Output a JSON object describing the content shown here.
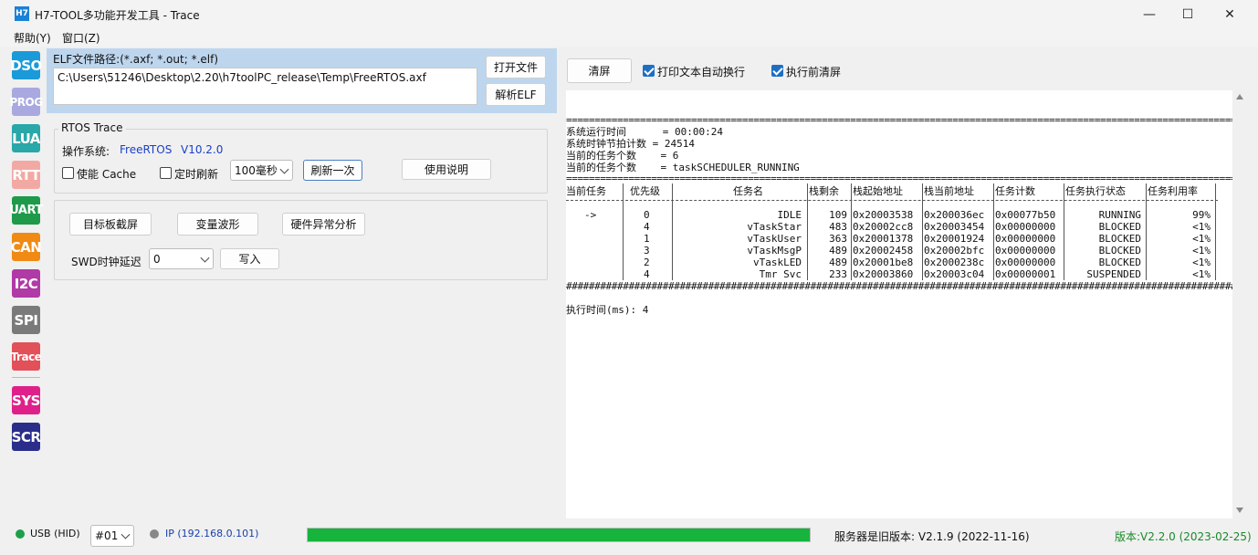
{
  "window": {
    "title": "H7-TOOL多功能开发工具 - Trace",
    "icon_label": "H7",
    "minimize_glyph": "—",
    "maximize_glyph": "☐",
    "close_glyph": "✕"
  },
  "menu": {
    "items": [
      "帮助(Y)",
      "窗口(Z)"
    ]
  },
  "sidebar": {
    "items": [
      {
        "label": "DSO",
        "color": "#1a9ad8"
      },
      {
        "label": "PROG",
        "color": "#a9a9e0"
      },
      {
        "label": "LUA",
        "color": "#2aa7a8"
      },
      {
        "label": "RTT",
        "color": "#f3a9a3"
      },
      {
        "label": "UART",
        "color": "#1e9a4a"
      },
      {
        "label": "CAN",
        "color": "#f08a14"
      },
      {
        "label": "I2C",
        "color": "#b03aa6"
      },
      {
        "label": "SPI",
        "color": "#7a7a7a"
      },
      {
        "label": "Trace",
        "color": "#e2505a"
      },
      {
        "label": "SYS",
        "color": "#e0208a"
      },
      {
        "label": "SCR",
        "color": "#2a2e8a"
      }
    ]
  },
  "elf": {
    "label": "ELF文件路径:(*.axf; *.out; *.elf)",
    "path": "C:\\Users\\51246\\Desktop\\2.20\\h7toolPC_release\\Temp\\FreeRTOS.axf",
    "open_button": "打开文件",
    "parse_button": "解析ELF"
  },
  "rtos": {
    "group_title": "RTOS Trace",
    "os_label": "操作系统:",
    "os_name": "FreeRTOS",
    "os_version": "V10.2.0",
    "cache_label": "使能 Cache",
    "cache_checked": false,
    "timer_label": "定时刷新",
    "timer_checked": false,
    "interval_value": "100毫秒",
    "refresh_once_button": "刷新一次",
    "help_button": "使用说明"
  },
  "tools": {
    "screenshot_button": "目标板截屏",
    "waveform_button": "变量波形",
    "fault_button": "硬件异常分析",
    "swd_label": "SWD时钟延迟",
    "swd_value": "0",
    "write_button": "写入"
  },
  "console_toolbar": {
    "clear_button": "清屏",
    "wrap_label": "打印文本自动换行",
    "wrap_checked": true,
    "clear_before_label": "执行前清屏",
    "clear_before_checked": true
  },
  "console": {
    "separator_eq": "=========================================================================================================================",
    "info_lines": [
      "系统运行时间      = 00:00:24",
      "系统时钟节拍计数 = 24514",
      "当前的任务个数    = 6",
      "当前的任务个数    = taskSCHEDULER_RUNNING"
    ],
    "table_headers": [
      "当前任务",
      "优先级",
      "任务名",
      "栈剩余",
      "栈起始地址",
      "栈当前地址",
      "任务计数",
      "任务执行状态",
      "任务利用率"
    ],
    "header_separator": "-----------+---------+----------------------------------+--------+-----------+----------+----------+----------+----------+",
    "rows": [
      {
        "current": "->",
        "priority": "0",
        "name": "IDLE",
        "stack_free": "109",
        "stack_start": "0x20003538",
        "stack_cur": "0x200036ec",
        "count": "0x00077b50",
        "state": "RUNNING",
        "usage": "99%"
      },
      {
        "current": "",
        "priority": "4",
        "name": "vTaskStar",
        "stack_free": "483",
        "stack_start": "0x20002cc8",
        "stack_cur": "0x20003454",
        "count": "0x00000000",
        "state": "BLOCKED",
        "usage": "<1%"
      },
      {
        "current": "",
        "priority": "1",
        "name": "vTaskUser",
        "stack_free": "363",
        "stack_start": "0x20001378",
        "stack_cur": "0x20001924",
        "count": "0x00000000",
        "state": "BLOCKED",
        "usage": "<1%"
      },
      {
        "current": "",
        "priority": "3",
        "name": "vTaskMsgP",
        "stack_free": "489",
        "stack_start": "0x20002458",
        "stack_cur": "0x20002bfc",
        "count": "0x00000000",
        "state": "BLOCKED",
        "usage": "<1%"
      },
      {
        "current": "",
        "priority": "2",
        "name": "vTaskLED",
        "stack_free": "489",
        "stack_start": "0x20001be8",
        "stack_cur": "0x2000238c",
        "count": "0x00000000",
        "state": "BLOCKED",
        "usage": "<1%"
      },
      {
        "current": "",
        "priority": "4",
        "name": "Tmr Svc",
        "stack_free": "233",
        "stack_start": "0x20003860",
        "stack_cur": "0x20003c04",
        "count": "0x00000001",
        "state": "SUSPENDED",
        "usage": "<1%"
      }
    ],
    "separator_hash": "#########################################################################################################################",
    "exec_time": "执行时间(ms): 4"
  },
  "statusbar": {
    "usb_label": "USB (HID)",
    "usb_color": "#1aa04a",
    "device_value": "#01",
    "ip_label": "IP (192.168.0.101)",
    "ip_color": "#888888",
    "progress_percent": 100,
    "progress_color": "#16b43c",
    "server_version": "服务器是旧版本: V2.1.9 (2022-11-16)",
    "app_version": "版本:V2.2.0 (2023-02-25)"
  }
}
